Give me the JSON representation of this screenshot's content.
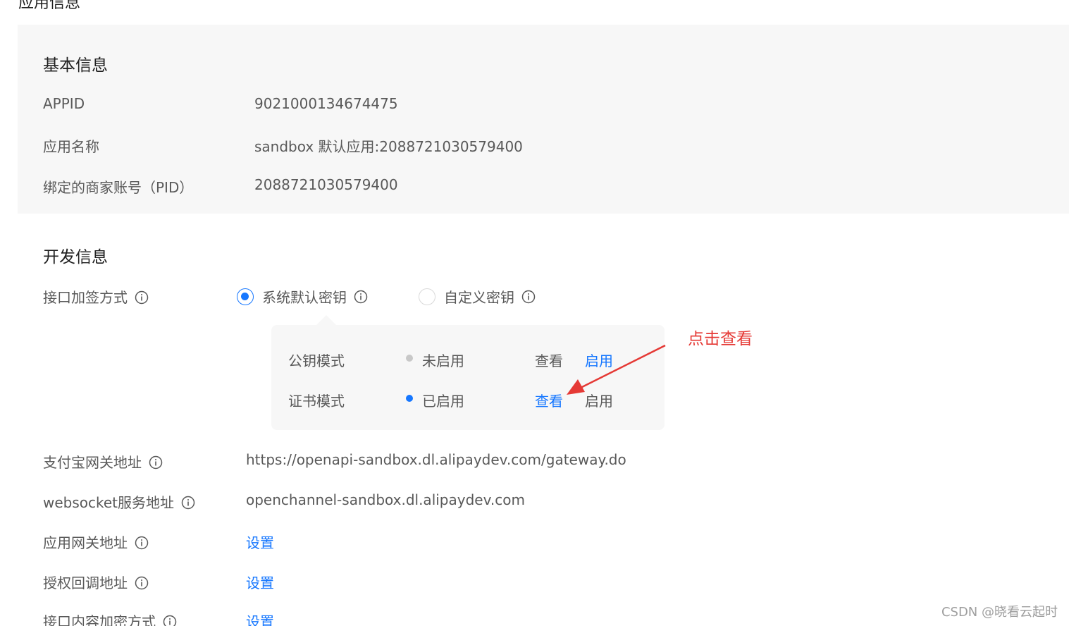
{
  "page_heading": "应用信息",
  "basic_info": {
    "title": "基本信息",
    "rows": [
      {
        "label": "APPID",
        "value": "9021000134674475"
      },
      {
        "label": "应用名称",
        "value": "sandbox 默认应用:2088721030579400"
      },
      {
        "label": "绑定的商家账号（PID）",
        "value": "2088721030579400"
      }
    ]
  },
  "dev_info": {
    "title": "开发信息",
    "sign_method": {
      "label": "接口加签方式",
      "options": [
        {
          "label": "系统默认密钥",
          "selected": true
        },
        {
          "label": "自定义密钥",
          "selected": false
        }
      ]
    },
    "key_modes": [
      {
        "name": "公钥模式",
        "status": "未启用",
        "status_color": "#c8c8c8",
        "view": "查看",
        "enable": "启用",
        "view_active": false,
        "enable_active": true
      },
      {
        "name": "证书模式",
        "status": "已启用",
        "status_color": "#1677ff",
        "view": "查看",
        "enable": "启用",
        "view_active": true,
        "enable_active": false
      }
    ],
    "gateway": {
      "label": "支付宝网关地址",
      "value": "https://openapi-sandbox.dl.alipaydev.com/gateway.do"
    },
    "websocket": {
      "label": "websocket服务地址",
      "value": "openchannel-sandbox.dl.alipaydev.com"
    },
    "app_gateway": {
      "label": "应用网关地址",
      "action": "设置"
    },
    "auth_callback": {
      "label": "授权回调地址",
      "action": "设置"
    },
    "content_encrypt": {
      "label": "接口内容加密方式",
      "action": "设置"
    }
  },
  "annotation": {
    "text": "点击查看",
    "color": "#e53935"
  },
  "watermark": "CSDN @晓看云起时",
  "colors": {
    "link": "#1677ff",
    "panel_bg": "#f7f7f7",
    "label": "#595959"
  }
}
